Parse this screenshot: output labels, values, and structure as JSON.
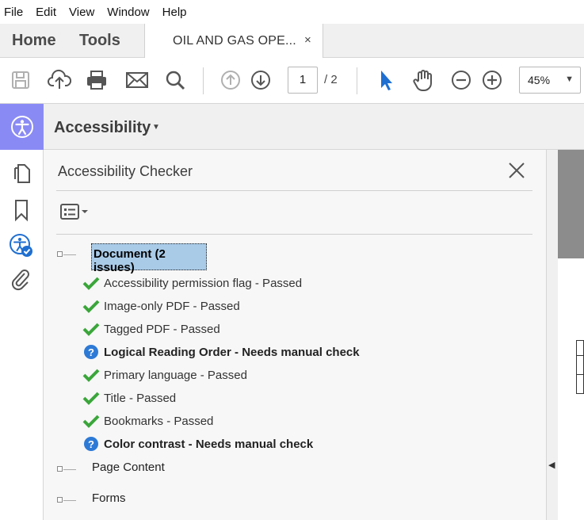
{
  "menu": [
    "File",
    "Edit",
    "View",
    "Window",
    "Help"
  ],
  "tabs": {
    "home": "Home",
    "tools": "Tools",
    "document": "OIL AND GAS OPE...",
    "close": "×"
  },
  "toolbar": {
    "page_current": "1",
    "page_total": "/ 2",
    "zoom": "45%",
    "icons": [
      "save-icon",
      "upload-icon",
      "print-icon",
      "email-icon",
      "search-icon",
      "prev-page-icon",
      "next-page-icon",
      "select-cursor-icon",
      "hand-icon",
      "zoom-out-icon",
      "zoom-in-icon"
    ]
  },
  "tool": {
    "title": "Accessibility",
    "caret": "▾"
  },
  "panel": {
    "title": "Accessibility Checker",
    "document_node": "Document (2 issues)",
    "checks": [
      {
        "label": "Accessibility permission flag - Passed",
        "status": "passed"
      },
      {
        "label": "Image-only PDF - Passed",
        "status": "passed"
      },
      {
        "label": "Tagged PDF - Passed",
        "status": "passed"
      },
      {
        "label": "Logical Reading Order - Needs manual check",
        "status": "manual"
      },
      {
        "label": "Primary language - Passed",
        "status": "passed"
      },
      {
        "label": "Title - Passed",
        "status": "passed"
      },
      {
        "label": "Bookmarks - Passed",
        "status": "passed"
      },
      {
        "label": "Color contrast - Needs manual check",
        "status": "manual"
      }
    ],
    "page_content": "Page Content",
    "forms": "Forms"
  },
  "colors": {
    "accent": "#8a8af5",
    "selection": "#a9cbe8",
    "passed": "#3aa63a",
    "manual": "#2d7ad6"
  }
}
